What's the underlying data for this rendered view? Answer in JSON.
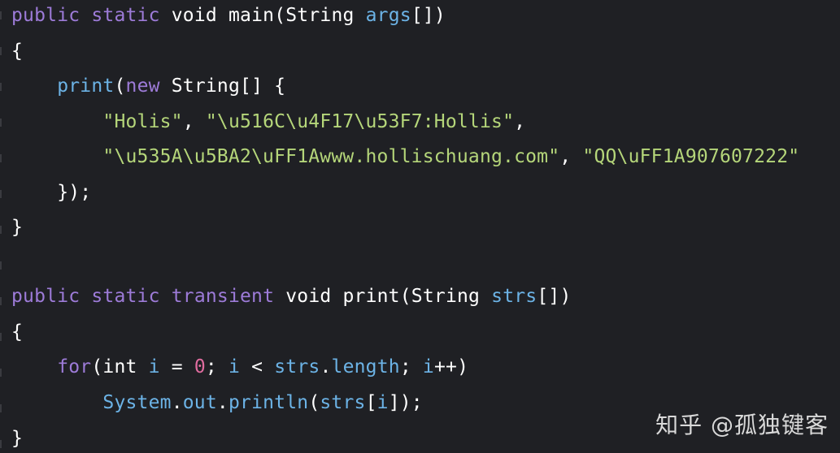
{
  "code": {
    "line1": {
      "kw1": "public",
      "kw2": "static",
      "ty": "void",
      "fn": "main",
      "open": "(",
      "cls": "String",
      "param": "args",
      "close": "[])"
    },
    "line2": {
      "brace": "{"
    },
    "line3": {
      "fn": "print",
      "open": "(",
      "kw": "new",
      "cls": "String",
      "rest": "[] {"
    },
    "line4": {
      "s1": "\"Holis\"",
      "sep": ", ",
      "s2": "\"\\u516C\\u4F17\\u53F7:Hollis\"",
      "end": ","
    },
    "line5": {
      "s1": "\"\\u535A\\u5BA2\\uFF1Awww.hollischuang.com\"",
      "sep": ", ",
      "s2": "\"QQ\\uFF1A907607222\""
    },
    "line6": {
      "text": "});"
    },
    "line7": {
      "brace": "}"
    },
    "line8": {
      "kw1": "public",
      "kw2": "static",
      "kw3": "transient",
      "ty": "void",
      "fn": "print",
      "open": "(",
      "cls": "String",
      "param": "strs",
      "close": "[])"
    },
    "line9": {
      "brace": "{"
    },
    "line10": {
      "kw": "for",
      "open": "(",
      "ty": "int",
      "var1": "i",
      "op1": " = ",
      "num": "0",
      "semi1": "; ",
      "var2": "i",
      "op2": " < ",
      "var3": "strs",
      "dot": ".",
      "prop": "length",
      "semi2": "; ",
      "var4": "i",
      "inc": "++)"
    },
    "line11": {
      "sys": "System",
      "dot1": ".",
      "out": "out",
      "dot2": ".",
      "method": "println",
      "open": "(",
      "var": "strs",
      "bracket_open": "[",
      "idx": "i",
      "close": "]);"
    },
    "line12": {
      "brace": "}"
    }
  },
  "watermark": "知乎 @孤独键客"
}
